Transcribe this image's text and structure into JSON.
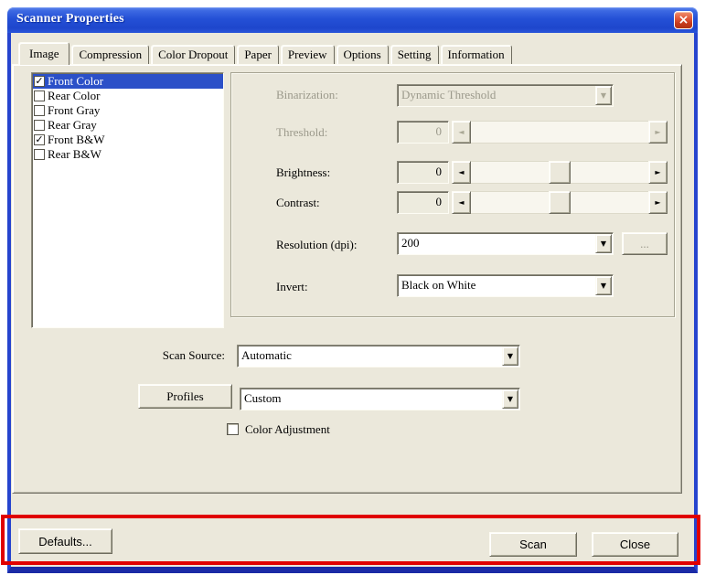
{
  "window": {
    "title": "Scanner Properties"
  },
  "icons": {
    "close": "×",
    "down": "▼",
    "left": "◄",
    "right": "►",
    "check": "✓"
  },
  "tabs": [
    {
      "label": "Image",
      "selected": true
    },
    {
      "label": "Compression",
      "selected": false
    },
    {
      "label": "Color Dropout",
      "selected": false
    },
    {
      "label": "Paper",
      "selected": false
    },
    {
      "label": "Preview",
      "selected": false
    },
    {
      "label": "Options",
      "selected": false
    },
    {
      "label": "Setting",
      "selected": false
    },
    {
      "label": "Information",
      "selected": false
    }
  ],
  "image_selection_list": {
    "items": [
      {
        "label": "Front Color",
        "checked": true,
        "selected": true
      },
      {
        "label": "Rear Color",
        "checked": false,
        "selected": false
      },
      {
        "label": "Front Gray",
        "checked": false,
        "selected": false
      },
      {
        "label": "Rear Gray",
        "checked": false,
        "selected": false
      },
      {
        "label": "Front B&W",
        "checked": true,
        "selected": false
      },
      {
        "label": "Rear B&W",
        "checked": false,
        "selected": false
      }
    ]
  },
  "settings_panel": {
    "binarization": {
      "label": "Binarization:",
      "value": "Dynamic Threshold",
      "disabled": true
    },
    "threshold": {
      "label": "Threshold:",
      "value": "0",
      "disabled": true
    },
    "brightness": {
      "label": "Brightness:",
      "value": "0",
      "disabled": false,
      "slider_position_pct": 50
    },
    "contrast": {
      "label": "Contrast:",
      "value": "0",
      "disabled": false,
      "slider_position_pct": 50
    },
    "resolution": {
      "label": "Resolution (dpi):",
      "value": "200",
      "more_button_label": "..."
    },
    "invert": {
      "label": "Invert:",
      "value": "Black on White"
    }
  },
  "scan_source": {
    "label": "Scan Source:",
    "value": "Automatic"
  },
  "profiles": {
    "button_label": "Profiles",
    "value": "Custom"
  },
  "color_adjustment": {
    "label": "Color Adjustment",
    "checked": false
  },
  "footer": {
    "defaults_label": "Defaults...",
    "scan_label": "Scan",
    "close_label": "Close"
  },
  "annotation": {
    "shape": "rectangle",
    "color": "#E00000"
  },
  "colors": {
    "titlebar": "#2450D6",
    "dialog_bg": "#EBE8DB",
    "selection_bg": "#2B50C8",
    "disabled_text": "#9B998B",
    "window_border": "#2644CE"
  }
}
